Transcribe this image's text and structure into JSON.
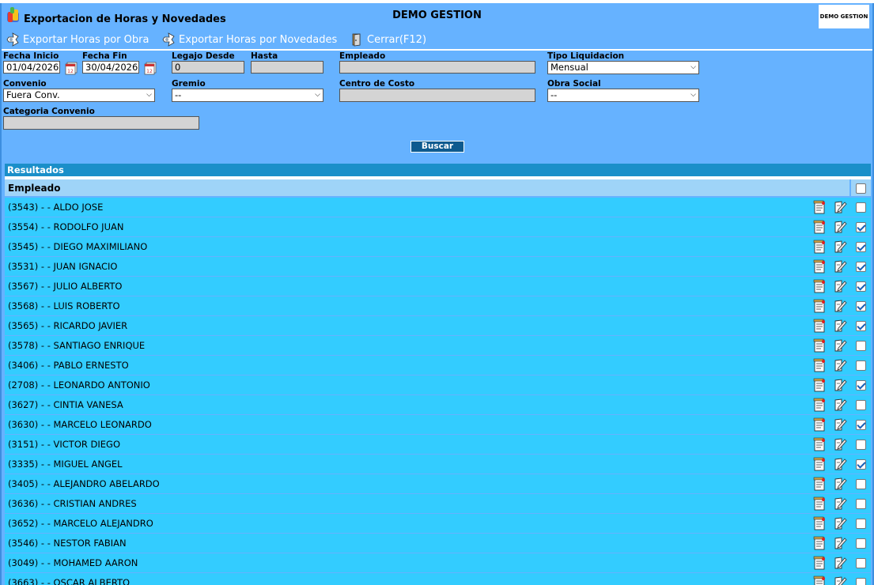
{
  "window": {
    "title": "Exportacion de Horas y Novedades",
    "company": "DEMO GESTION",
    "logo_text": "DEMO GESTION"
  },
  "toolbar": {
    "export_by_work_label": "Exportar Horas por Obra",
    "export_by_news_label": "Exportar Horas por Novedades",
    "close_label": "Cerrar(F12)"
  },
  "filters": {
    "fecha_inicio": {
      "label": "Fecha Inicio",
      "value": "01/04/2026"
    },
    "fecha_fin": {
      "label": "Fecha Fin",
      "value": "30/04/2026"
    },
    "legajo_desde": {
      "label": "Legajo Desde",
      "value": "0"
    },
    "hasta": {
      "label": "Hasta",
      "value": ""
    },
    "empleado": {
      "label": "Empleado",
      "value": ""
    },
    "tipo_liquidacion": {
      "label": "Tipo Liquidacion",
      "value": "Mensual"
    },
    "convenio": {
      "label": "Convenio",
      "value": "Fuera Conv."
    },
    "gremio": {
      "label": "Gremio",
      "value": "--"
    },
    "centro_costo": {
      "label": "Centro de Costo",
      "value": ""
    },
    "obra_social": {
      "label": "Obra Social",
      "value": "--"
    },
    "categoria_convenio": {
      "label": "Categoria Convenio",
      "value": ""
    },
    "search_label": "Buscar"
  },
  "results": {
    "title": "Resultados",
    "column_employee": "Empleado",
    "select_all_checked": false,
    "rows": [
      {
        "label": "(3543) - - ALDO JOSE",
        "checked": false
      },
      {
        "label": "(3554) - - RODOLFO JUAN",
        "checked": true
      },
      {
        "label": "(3545) - - DIEGO MAXIMILIANO",
        "checked": true
      },
      {
        "label": "(3531) - - JUAN IGNACIO",
        "checked": true
      },
      {
        "label": "(3567) - - JULIO ALBERTO",
        "checked": true
      },
      {
        "label": "(3568) - - LUIS ROBERTO",
        "checked": true
      },
      {
        "label": "(3565) - - RICARDO JAVIER",
        "checked": true
      },
      {
        "label": "(3578) - - SANTIAGO ENRIQUE",
        "checked": false
      },
      {
        "label": "(3406) - - PABLO ERNESTO",
        "checked": false
      },
      {
        "label": "(2708) - - LEONARDO ANTONIO",
        "checked": true
      },
      {
        "label": "(3627) - - CINTIA VANESA",
        "checked": false
      },
      {
        "label": "(3630) - - MARCELO LEONARDO",
        "checked": true
      },
      {
        "label": "(3151) - - VICTOR DIEGO",
        "checked": false
      },
      {
        "label": "(3335) - - MIGUEL ANGEL",
        "checked": true
      },
      {
        "label": "(3405) - - ALEJANDRO ABELARDO",
        "checked": false
      },
      {
        "label": "(3636) - - CRISTIAN ANDRES",
        "checked": false
      },
      {
        "label": "(3652) - - MARCELO ALEJANDRO",
        "checked": false
      },
      {
        "label": "(3546) - - NESTOR FABIAN",
        "checked": false
      },
      {
        "label": "(3049) - - MOHAMED AARON",
        "checked": false
      },
      {
        "label": "(3663) - - OSCAR ALBERTO",
        "checked": false
      }
    ]
  }
}
